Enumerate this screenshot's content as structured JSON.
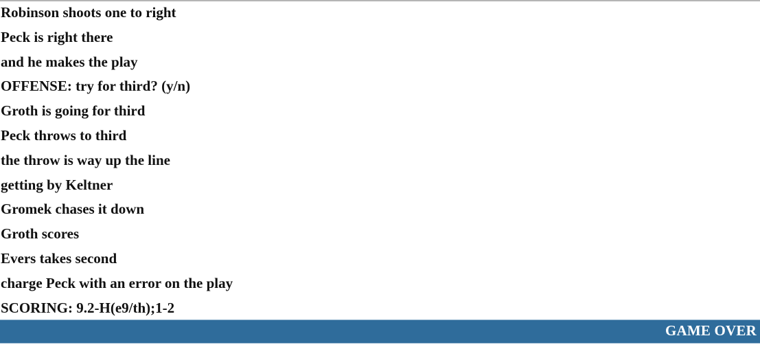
{
  "play_log": [
    "Robinson shoots one to right",
    "Peck is right there",
    "and he makes the play",
    "OFFENSE: try for third? (y/n)",
    "Groth is going for third",
    "Peck throws to third",
    "the throw is way up the line",
    "getting by Keltner",
    "Gromek chases it down",
    "Groth scores",
    "Evers takes second",
    "charge Peck with an error on the play",
    "SCORING: 9.2-H(e9/th);1-2"
  ],
  "status_bar": {
    "label": "GAME OVER",
    "color": "#2f6c9b"
  }
}
